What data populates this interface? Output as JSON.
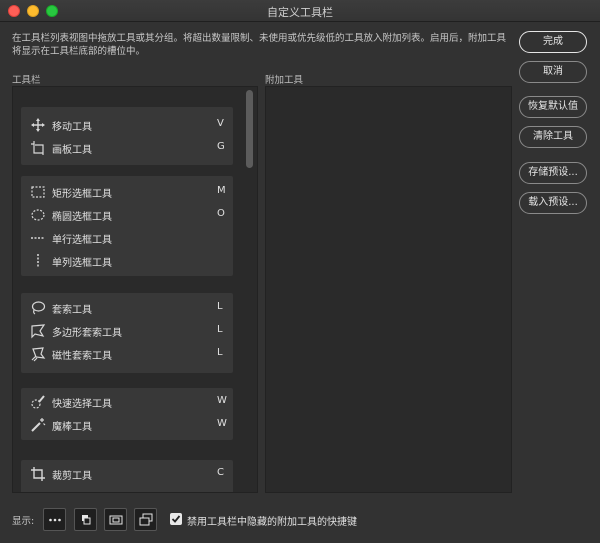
{
  "window": {
    "title": "自定义工具栏"
  },
  "description": "在工具栏列表视图中拖放工具或其分组。将超出数量限制、未使用或优先级低的工具放入附加列表。启用后，附加工具将显示在工具栏底部的槽位中。",
  "toolbar": {
    "label": "工具栏",
    "groups": [
      {
        "tools": [
          {
            "name": "移动工具",
            "key": "V",
            "icon": "move-icon"
          },
          {
            "name": "画板工具",
            "key": "G",
            "icon": "artboard-icon"
          }
        ]
      },
      {
        "tools": [
          {
            "name": "矩形选框工具",
            "key": "M",
            "icon": "rect-marquee-icon"
          },
          {
            "name": "椭圆选框工具",
            "key": "O",
            "icon": "ellipse-marquee-icon"
          },
          {
            "name": "单行选框工具",
            "key": "",
            "icon": "single-row-marquee-icon"
          },
          {
            "name": "单列选框工具",
            "key": "",
            "icon": "single-column-marquee-icon"
          }
        ]
      },
      {
        "tools": [
          {
            "name": "套索工具",
            "key": "L",
            "icon": "lasso-icon"
          },
          {
            "name": "多边形套索工具",
            "key": "L",
            "icon": "polygon-lasso-icon"
          },
          {
            "name": "磁性套索工具",
            "key": "L",
            "icon": "magnetic-lasso-icon"
          }
        ]
      },
      {
        "tools": [
          {
            "name": "快速选择工具",
            "key": "W",
            "icon": "quick-select-icon"
          },
          {
            "name": "魔棒工具",
            "key": "W",
            "icon": "magic-wand-icon"
          }
        ]
      },
      {
        "tools": [
          {
            "name": "裁剪工具",
            "key": "C",
            "icon": "crop-icon"
          }
        ]
      }
    ]
  },
  "extra_tools": {
    "label": "附加工具"
  },
  "buttons": {
    "done": "完成",
    "cancel": "取消",
    "restore_defaults": "恢复默认值",
    "clear_tools": "清除工具",
    "save_preset": "存储预设...",
    "load_preset": "载入预设..."
  },
  "footer": {
    "show_label": "显示:",
    "modes": [
      "more-dots-icon",
      "quick-mask-icon",
      "screen-mode-icon",
      "arrange-windows-icon"
    ],
    "checkbox_label": "禁用工具栏中隐藏的附加工具的快捷键",
    "checkbox_checked": true
  }
}
